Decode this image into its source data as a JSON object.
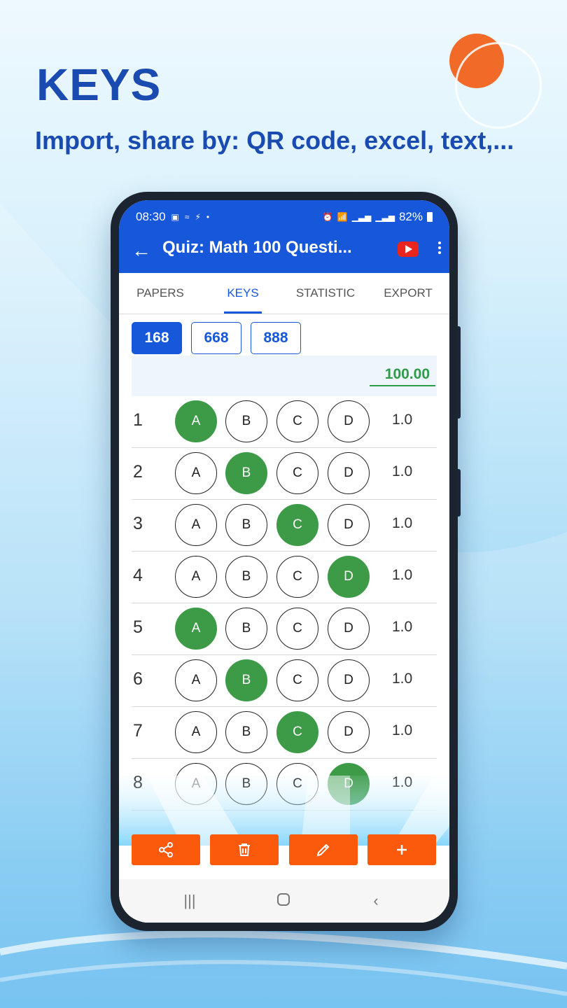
{
  "hero": {
    "title": "KEYS",
    "subtitle": "Import, share by: QR code, excel, text,..."
  },
  "status_bar": {
    "time": "08:30",
    "battery": "82%",
    "left_icons": [
      "gallery-icon",
      "signal-icon",
      "tasker-icon",
      "dot-icon"
    ],
    "right_icons": [
      "alarm-icon",
      "wifi-icon",
      "volte-icon",
      "signal-icon",
      "signal-icon",
      "battery-icon"
    ]
  },
  "app_bar": {
    "title": "Quiz: Math 100 Questi...",
    "back_icon": "arrow-left-icon",
    "youtube_icon": "youtube-icon",
    "more_icon": "more-vertical-icon"
  },
  "tabs": [
    {
      "label": "PAPERS",
      "active": false
    },
    {
      "label": "KEYS",
      "active": true
    },
    {
      "label": "STATISTIC",
      "active": false
    },
    {
      "label": "EXPORT",
      "active": false
    }
  ],
  "keys": [
    {
      "label": "168",
      "selected": true
    },
    {
      "label": "668",
      "selected": false
    },
    {
      "label": "888",
      "selected": false
    }
  ],
  "total_score": "100.00",
  "options": [
    "A",
    "B",
    "C",
    "D"
  ],
  "questions": [
    {
      "num": "1",
      "answer": "A",
      "score": "1.0"
    },
    {
      "num": "2",
      "answer": "B",
      "score": "1.0"
    },
    {
      "num": "3",
      "answer": "C",
      "score": "1.0"
    },
    {
      "num": "4",
      "answer": "D",
      "score": "1.0"
    },
    {
      "num": "5",
      "answer": "A",
      "score": "1.0"
    },
    {
      "num": "6",
      "answer": "B",
      "score": "1.0"
    },
    {
      "num": "7",
      "answer": "C",
      "score": "1.0"
    },
    {
      "num": "8",
      "answer": "D",
      "score": "1.0"
    }
  ],
  "actions": [
    {
      "icon": "share-icon"
    },
    {
      "icon": "trash-icon"
    },
    {
      "icon": "pencil-icon"
    },
    {
      "icon": "plus-icon"
    }
  ],
  "colors": {
    "primary": "#1757d9",
    "accent_orange": "#fb5a0c",
    "correct_green": "#3d9b47",
    "hero_text": "#1a4bb0"
  }
}
